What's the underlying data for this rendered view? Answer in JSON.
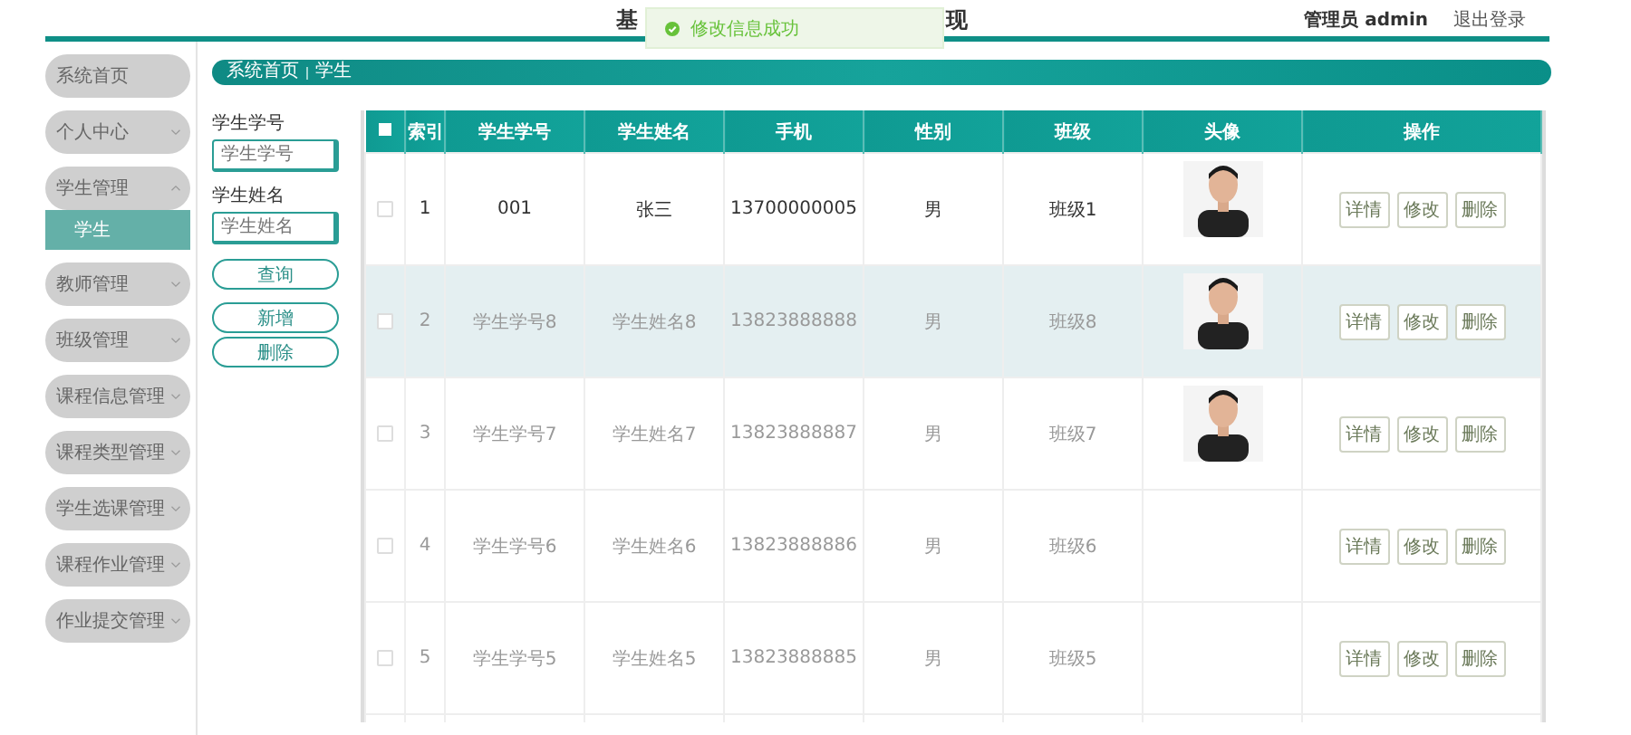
{
  "header": {
    "title_start": "基",
    "title_end": "现",
    "user": "管理员 admin",
    "logout": "退出登录"
  },
  "toast": {
    "message": "修改信息成功"
  },
  "sidebar": {
    "items": [
      {
        "label": "系统首页",
        "has_caret": false
      },
      {
        "label": "个人中心",
        "expanded": false,
        "has_caret": true
      },
      {
        "label": "学生管理",
        "expanded": true,
        "has_caret": true,
        "children": [
          {
            "label": "学生",
            "selected": true
          }
        ]
      },
      {
        "label": "教师管理",
        "expanded": false,
        "has_caret": true
      },
      {
        "label": "班级管理",
        "expanded": false,
        "has_caret": true
      },
      {
        "label": "课程信息管理",
        "expanded": false,
        "has_caret": true
      },
      {
        "label": "课程类型管理",
        "expanded": false,
        "has_caret": true
      },
      {
        "label": "学生选课管理",
        "expanded": false,
        "has_caret": true
      },
      {
        "label": "课程作业管理",
        "expanded": false,
        "has_caret": true
      },
      {
        "label": "作业提交管理",
        "expanded": false,
        "has_caret": true
      }
    ]
  },
  "breadcrumb": [
    "系统首页",
    "学生"
  ],
  "filters": [
    {
      "label": "学生学号",
      "placeholder": "学生学号"
    },
    {
      "label": "学生姓名",
      "placeholder": "学生姓名"
    }
  ],
  "filter_buttons": [
    "查询",
    "新增",
    "删除"
  ],
  "table": {
    "all_checked": false,
    "columns": [
      "索引",
      "学生学号",
      "学生姓名",
      "手机",
      "性别",
      "班级",
      "头像",
      "操作"
    ],
    "rows": [
      {
        "checked": false,
        "hovered": false,
        "muted": false,
        "index": "1",
        "student_no": "001",
        "name": "张三",
        "phone": "13700000005",
        "gender": "男",
        "class": "班级1",
        "actions": [
          "详情",
          "修改",
          "删除"
        ]
      },
      {
        "checked": false,
        "hovered": true,
        "muted": true,
        "index": "2",
        "student_no": "学生学号8",
        "name": "学生姓名8",
        "phone": "13823888888",
        "gender": "男",
        "class": "班级8",
        "actions": [
          "详情",
          "修改",
          "删除"
        ]
      },
      {
        "checked": false,
        "hovered": false,
        "muted": true,
        "index": "3",
        "student_no": "学生学号7",
        "name": "学生姓名7",
        "phone": "13823888887",
        "gender": "男",
        "class": "班级7",
        "actions": [
          "详情",
          "修改",
          "删除"
        ]
      },
      {
        "checked": false,
        "hovered": false,
        "muted": true,
        "index": "4",
        "student_no": "学生学号6",
        "name": "学生姓名6",
        "phone": "13823888886",
        "gender": "男",
        "class": "班级6",
        "actions": [
          "详情",
          "修改",
          "删除"
        ]
      },
      {
        "checked": false,
        "hovered": false,
        "muted": true,
        "index": "5",
        "student_no": "学生学号5",
        "name": "学生姓名5",
        "phone": "13823888885",
        "gender": "男",
        "class": "班级5",
        "actions": [
          "详情",
          "修改",
          "删除"
        ]
      }
    ]
  }
}
